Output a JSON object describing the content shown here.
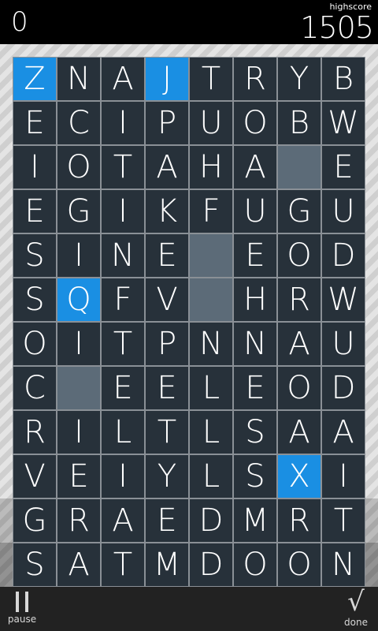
{
  "header": {
    "score": "0",
    "highscore_label": "highscore",
    "highscore": "1505"
  },
  "board": {
    "rows": [
      [
        "Z",
        "N",
        "A",
        "J",
        "T",
        "R",
        "Y",
        "B"
      ],
      [
        "E",
        "C",
        "I",
        "P",
        "U",
        "O",
        "B",
        "W"
      ],
      [
        "I",
        "O",
        "T",
        "A",
        "H",
        "A",
        "",
        "E"
      ],
      [
        "E",
        "G",
        "I",
        "K",
        "F",
        "U",
        "G",
        "U"
      ],
      [
        "S",
        "I",
        "N",
        "E",
        "",
        "E",
        "O",
        "D"
      ],
      [
        "S",
        "Q",
        "F",
        "V",
        "",
        "H",
        "R",
        "W"
      ],
      [
        "O",
        "I",
        "T",
        "P",
        "N",
        "N",
        "A",
        "U"
      ],
      [
        "C",
        "",
        "E",
        "E",
        "L",
        "E",
        "O",
        "D"
      ],
      [
        "R",
        "I",
        "L",
        "T",
        "L",
        "S",
        "A",
        "A"
      ],
      [
        "V",
        "E",
        "I",
        "Y",
        "L",
        "S",
        "X",
        "I"
      ],
      [
        "G",
        "R",
        "A",
        "E",
        "D",
        "M",
        "R",
        "T"
      ],
      [
        "S",
        "A",
        "T",
        "M",
        "D",
        "O",
        "O",
        "N"
      ]
    ],
    "highlighted": [
      [
        0,
        0
      ],
      [
        0,
        3
      ],
      [
        5,
        1
      ],
      [
        9,
        6
      ]
    ]
  },
  "footer": {
    "pause_label": "pause",
    "done_label": "done",
    "done_icon": "√"
  },
  "colors": {
    "tile": "#27313a",
    "tile_selected": "#1a8fe3",
    "tile_empty": "#5c6b78"
  }
}
